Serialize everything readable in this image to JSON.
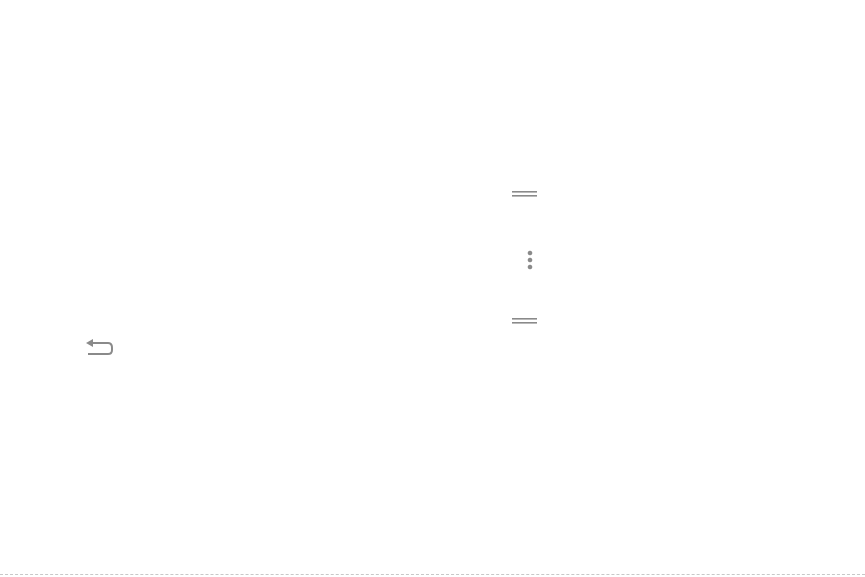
{
  "icons": [
    {
      "name": "back-icon",
      "color": "#8a8a8a"
    },
    {
      "name": "drag-handle-icon",
      "color": "#8a8a8a"
    },
    {
      "name": "more-options-icon",
      "color": "#8a8a8a"
    },
    {
      "name": "drag-handle-icon",
      "color": "#8a8a8a"
    }
  ],
  "colors": {
    "background": "#ffffff",
    "icon": "#8a8a8a"
  }
}
